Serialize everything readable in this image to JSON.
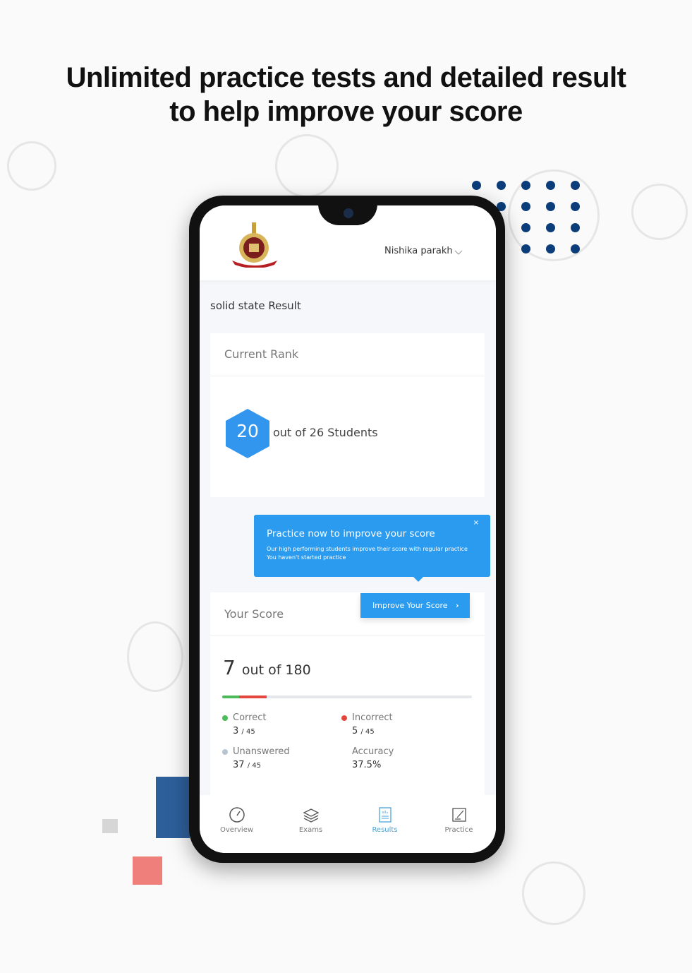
{
  "headline": {
    "line1": "Unlimited practice tests and detailed result",
    "line2": "to help improve your score"
  },
  "colors": {
    "accent": "#2b9bf0",
    "dots": "#0b3d7a",
    "correct": "#4cbb5a",
    "incorrect": "#e5463e",
    "unanswered": "#b8c4cf"
  },
  "header": {
    "user_name": "Nishika parakh",
    "logo": "institute-crest-logo"
  },
  "page_title": "solid state Result",
  "rank": {
    "title": "Current Rank",
    "rank": "20",
    "suffix": "out of 26 Students"
  },
  "tooltip": {
    "title": "Practice now to improve your score",
    "line1": "Our high performing students improve their score with regular practice",
    "line2": "You haven't started practice",
    "close": "×"
  },
  "score": {
    "title": "Your Score",
    "button": "Improve Your Score",
    "value": "7",
    "suffix": "out of 180",
    "progress": {
      "correct_fraction": 0.0667,
      "incorrect_fraction": 0.1111
    },
    "stats": {
      "correct_label": "Correct",
      "correct_value": "3",
      "correct_total": "/ 45",
      "incorrect_label": "Incorrect",
      "incorrect_value": "5",
      "incorrect_total": "/ 45",
      "unanswered_label": "Unanswered",
      "unanswered_value": "37",
      "unanswered_total": "/ 45",
      "accuracy_label": "Accuracy",
      "accuracy_value": "37.5%"
    }
  },
  "nav": [
    {
      "label": "Overview",
      "icon": "gauge-icon"
    },
    {
      "label": "Exams",
      "icon": "layers-icon"
    },
    {
      "label": "Results",
      "icon": "report-icon",
      "active": true
    },
    {
      "label": "Practice",
      "icon": "edit-icon"
    }
  ]
}
